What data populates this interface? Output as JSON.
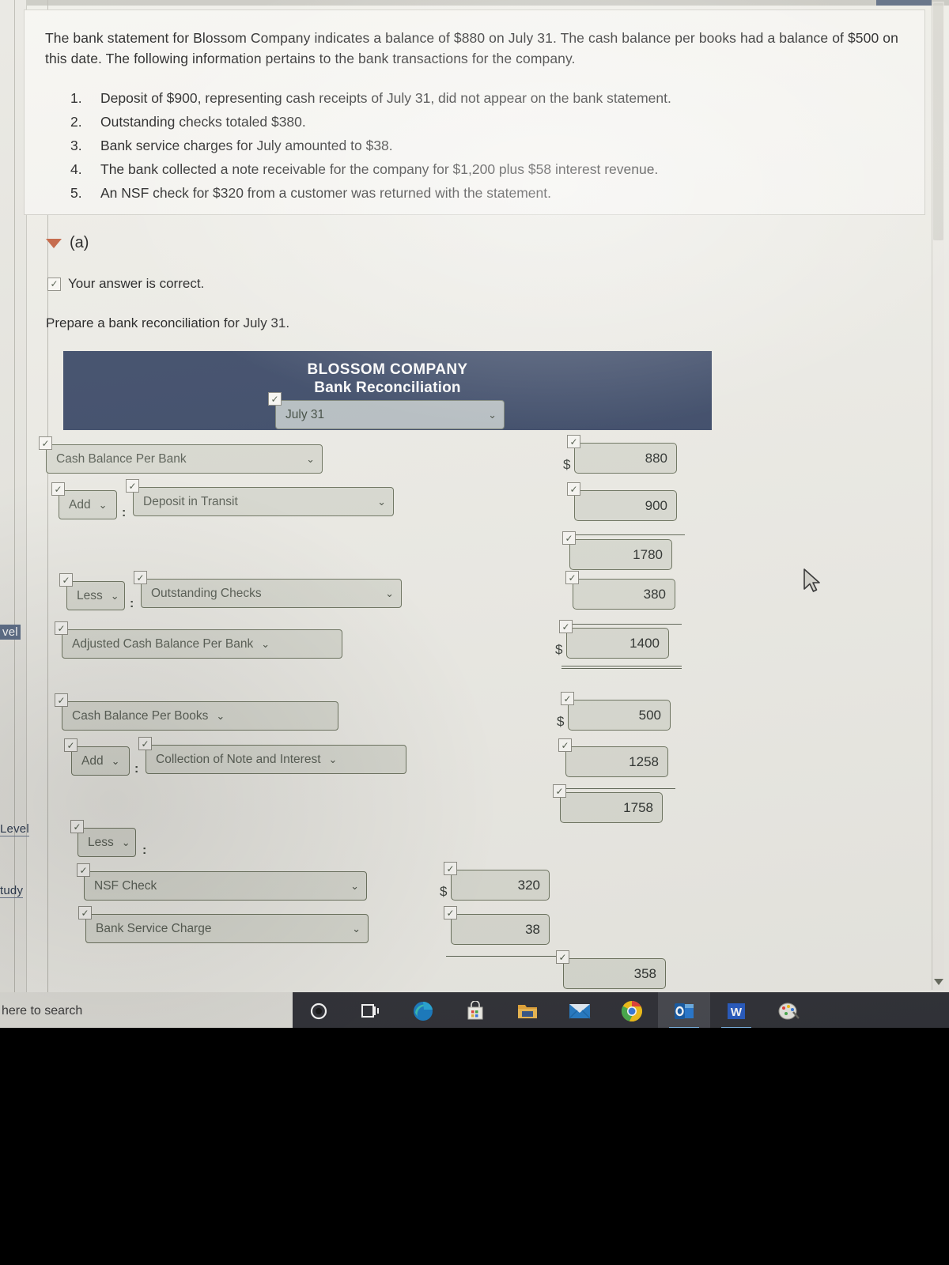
{
  "question": {
    "paragraph": "The bank statement for Blossom Company indicates a balance of $880 on July 31. The cash balance per books had a balance of $500 on this date. The following information pertains to the bank transactions for the company.",
    "items": [
      "Deposit of $900, representing cash receipts of July 31, did not appear on the bank statement.",
      "Outstanding checks totaled $380.",
      "Bank service charges for July amounted to $38.",
      "The bank collected a note receivable for the company for $1,200 plus $58 interest revenue.",
      "An NSF check for $320 from a customer was returned with the statement."
    ]
  },
  "part": {
    "label": "(a)",
    "status": "Your answer is correct.",
    "prompt": "Prepare a bank reconciliation for July 31."
  },
  "recon": {
    "company": "BLOSSOM COMPANY",
    "title": "Bank Reconciliation",
    "date_value": "July 31",
    "bank_section": {
      "opening_label": "Cash Balance Per Bank",
      "opening_amount": "880",
      "opening_currency": "$",
      "add_op": "Add",
      "add_label": "Deposit in Transit",
      "add_amount": "900",
      "subtotal_amount": "1780",
      "less_op": "Less",
      "less_label": "Outstanding Checks",
      "less_amount": "380",
      "adjusted_label": "Adjusted Cash Balance Per Bank",
      "adjusted_amount": "1400",
      "adjusted_currency": "$"
    },
    "books_section": {
      "opening_label": "Cash Balance Per Books",
      "opening_amount": "500",
      "opening_currency": "$",
      "add_op": "Add",
      "add_label": "Collection of Note and Interest",
      "add_amount": "1258",
      "subtotal_amount": "1758",
      "less_op": "Less",
      "less_item_1_label": "NSF Check",
      "less_item_1_amount": "320",
      "less_item_1_currency": "$",
      "less_item_2_label": "Bank Service Charge",
      "less_item_2_amount": "38",
      "less_total_amount": "358"
    },
    "colon": ":",
    "caret": "⌄",
    "header_color": "#3c4a68",
    "accent_color": "#c4603f"
  },
  "sidebar_fragments": {
    "frag_a": "vel",
    "frag_b": "Level",
    "frag_c": "tudy"
  },
  "taskbar": {
    "search_text": "here to search",
    "icons": [
      "cortana-circle-icon",
      "task-view-icon",
      "edge-browser-icon",
      "microsoft-store-icon",
      "file-explorer-icon",
      "mail-icon",
      "chrome-browser-icon",
      "outlook-icon",
      "word-icon",
      "paint-icon"
    ]
  }
}
